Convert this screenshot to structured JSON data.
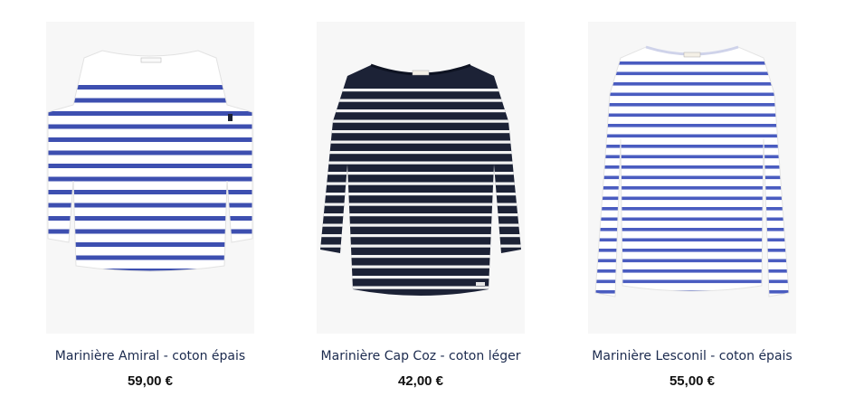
{
  "products": [
    {
      "name": "Marinière Amiral - coton épais",
      "price": "59,00 €",
      "image": "shirt-white-yoke-royal-blue-stripes-icon",
      "colors": {
        "base": "#ffffff",
        "stripe": "#3d4fb0"
      }
    },
    {
      "name": "Marinière Cap Coz - coton léger",
      "price": "42,00 €",
      "image": "shirt-navy-white-stripes-icon",
      "colors": {
        "base": "#1c2236",
        "stripe": "#f2f2f2"
      }
    },
    {
      "name": "Marinière Lesconil - coton épais",
      "price": "55,00 €",
      "image": "shirt-long-sleeve-blue-stripes-icon",
      "colors": {
        "base": "#ffffff",
        "stripe": "#4a5cc0"
      }
    }
  ]
}
